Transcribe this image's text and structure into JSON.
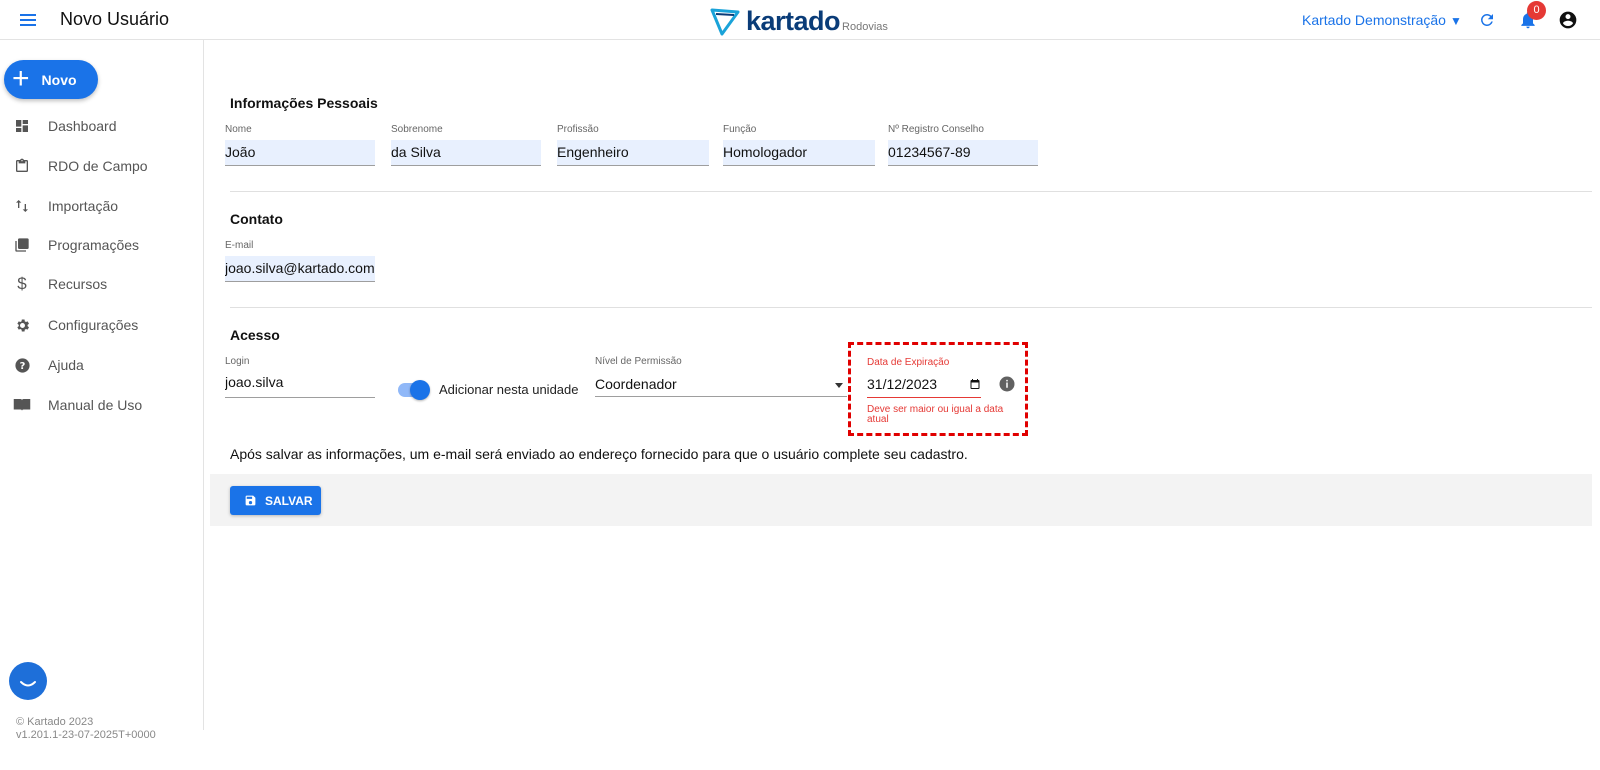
{
  "header": {
    "title": "Novo Usuário",
    "logo_word": "kartado",
    "logo_sub": "Rodovias",
    "organization": "Kartado Demonstração",
    "organization_caret": "▼",
    "notifications_count": "0"
  },
  "sidebar": {
    "new_button": "Novo",
    "items": [
      {
        "label": "Dashboard",
        "icon": "dashboard-icon"
      },
      {
        "label": "RDO de Campo",
        "icon": "clipboard-icon"
      },
      {
        "label": "Importação",
        "icon": "import-arrows-icon"
      },
      {
        "label": "Programações",
        "icon": "library-books-icon"
      },
      {
        "label": "Recursos",
        "icon": "dollar-icon"
      },
      {
        "label": "Configurações",
        "icon": "gear-icon"
      },
      {
        "label": "Ajuda",
        "icon": "help-icon"
      },
      {
        "label": "Manual de Uso",
        "icon": "book-icon"
      }
    ],
    "footer_copyright": "© Kartado 2023",
    "footer_version": "v1.201.1-23-07-2025T+0000"
  },
  "form": {
    "personal": {
      "title": "Informações Pessoais",
      "fields": [
        {
          "label": "Nome",
          "value": "João"
        },
        {
          "label": "Sobrenome",
          "value": "da Silva"
        },
        {
          "label": "Profissão",
          "value": "Engenheiro"
        },
        {
          "label": "Função",
          "value": "Homologador"
        },
        {
          "label": "Nº Registro Conselho",
          "value": "01234567-89"
        }
      ]
    },
    "contact": {
      "title": "Contato",
      "email_label": "E-mail",
      "email_value": "joao.silva@kartado.com.b"
    },
    "access": {
      "title": "Acesso",
      "login_label": "Login",
      "login_value": "joao.silva",
      "toggle_label": "Adicionar nesta unidade",
      "toggle_on": true,
      "permission_label": "Nível de Permissão",
      "permission_value": "Coordenador",
      "expiration_label": "Data de Expiração",
      "expiration_value": "31/12/2023",
      "expiration_error": "Deve ser maior ou igual a data atual"
    },
    "notice": "Após salvar as informações, um e-mail será enviado ao endereço fornecido para que o usuário complete seu cadastro.",
    "save_label": "SALVAR"
  },
  "colors": {
    "primary": "#1a73e8",
    "error": "#e53935",
    "logo": "#0a3c78",
    "field_bg": "#e8f0fe"
  }
}
